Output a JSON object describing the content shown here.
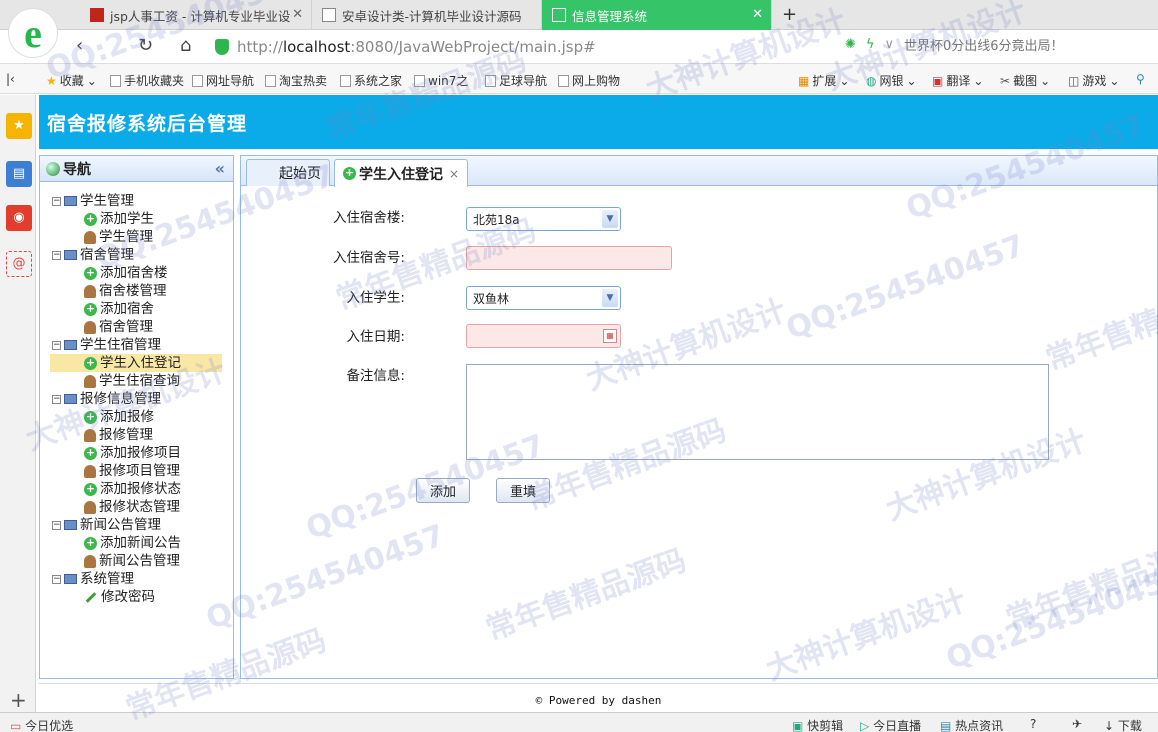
{
  "browser": {
    "tabs": [
      {
        "title": "jsp人事工资 - 计算机专业毕业设"
      },
      {
        "title": "安卓设计类-计算机毕业设计源码"
      },
      {
        "title": "信息管理系统"
      }
    ],
    "url_prefix": "http://",
    "url_host": "localhost",
    "url_path": ":8080/JavaWebProject/main.jsp#",
    "news": "世界杯0分出线6分竟出局！",
    "bookmarks": [
      "收藏",
      "手机收藏夹",
      "网址导航",
      "淘宝热卖",
      "系统之家",
      "win7之",
      "足球导航",
      "网上购物"
    ],
    "toolbar_right": [
      "扩展",
      "网银",
      "翻译",
      "截图",
      "游戏"
    ],
    "status_left": "今日优选",
    "status_right": [
      "快剪辑",
      "今日直播",
      "热点资讯",
      "下载"
    ]
  },
  "app": {
    "title": "宿舍报修系统后台管理",
    "nav_title": "导航",
    "collapse_symbol": "«",
    "tree": [
      {
        "label": "学生管理",
        "children": [
          "添加学生",
          "学生管理"
        ]
      },
      {
        "label": "宿舍管理",
        "children": [
          "添加宿舍楼",
          "宿舍楼管理",
          "添加宿舍",
          "宿舍管理"
        ]
      },
      {
        "label": "学生住宿管理",
        "children": [
          "学生入住登记",
          "学生住宿查询"
        ]
      },
      {
        "label": "报修信息管理",
        "children": [
          "添加报修",
          "报修管理",
          "添加报修项目",
          "报修项目管理",
          "添加报修状态",
          "报修状态管理"
        ]
      },
      {
        "label": "新闻公告管理",
        "children": [
          "添加新闻公告",
          "新闻公告管理"
        ]
      },
      {
        "label": "系统管理",
        "children": [
          "修改密码"
        ]
      }
    ],
    "selected_item": "学生入住登记",
    "tabs": [
      {
        "label": "起始页"
      },
      {
        "label": "学生入住登记",
        "close": "×"
      }
    ],
    "form": {
      "building_label": "入住宿舍楼:",
      "building_value": "北苑18a",
      "room_label": "入住宿舍号:",
      "room_value": "",
      "student_label": "入住学生:",
      "student_value": "双鱼林",
      "date_label": "入住日期:",
      "date_value": "",
      "memo_label": "备注信息:",
      "memo_value": "",
      "add_button": "添加",
      "reset_button": "重填"
    },
    "footer": "Powered by dashen"
  },
  "watermarks": [
    "QQ:254540457",
    "常年售精品源码",
    "大神计算机设计"
  ]
}
